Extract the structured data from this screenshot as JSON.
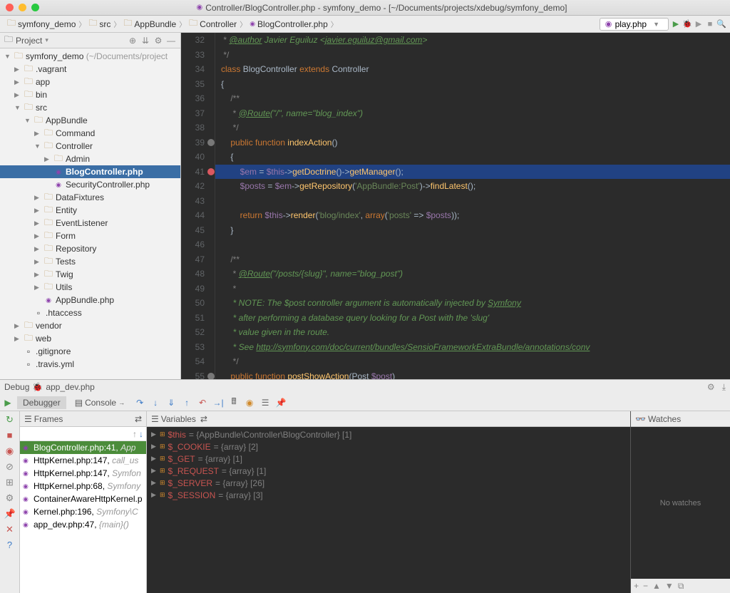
{
  "title": "Controller/BlogController.php - symfony_demo - [~/Documents/projects/xdebug/symfony_demo]",
  "breadcrumbs": [
    "symfony_demo",
    "src",
    "AppBundle",
    "Controller",
    "BlogController.php"
  ],
  "runconfig": "play.php",
  "projectPanel": {
    "title": "Project"
  },
  "tree": [
    {
      "depth": 0,
      "arrow": "▼",
      "icon": "folder",
      "label": "symfony_demo",
      "suffix": " (~/Documents/project"
    },
    {
      "depth": 1,
      "arrow": "▶",
      "icon": "folder",
      "label": ".vagrant"
    },
    {
      "depth": 1,
      "arrow": "▶",
      "icon": "folder",
      "label": "app"
    },
    {
      "depth": 1,
      "arrow": "▶",
      "icon": "folder",
      "label": "bin"
    },
    {
      "depth": 1,
      "arrow": "▼",
      "icon": "folder",
      "label": "src"
    },
    {
      "depth": 2,
      "arrow": "▼",
      "icon": "folder",
      "label": "AppBundle"
    },
    {
      "depth": 3,
      "arrow": "▶",
      "icon": "folder",
      "label": "Command"
    },
    {
      "depth": 3,
      "arrow": "▼",
      "icon": "folder",
      "label": "Controller"
    },
    {
      "depth": 4,
      "arrow": "▶",
      "icon": "folder",
      "label": "Admin"
    },
    {
      "depth": 4,
      "arrow": "",
      "icon": "php",
      "label": "BlogController.php",
      "selected": true
    },
    {
      "depth": 4,
      "arrow": "",
      "icon": "php",
      "label": "SecurityController.php"
    },
    {
      "depth": 3,
      "arrow": "▶",
      "icon": "folder",
      "label": "DataFixtures"
    },
    {
      "depth": 3,
      "arrow": "▶",
      "icon": "folder",
      "label": "Entity"
    },
    {
      "depth": 3,
      "arrow": "▶",
      "icon": "folder",
      "label": "EventListener"
    },
    {
      "depth": 3,
      "arrow": "▶",
      "icon": "folder",
      "label": "Form"
    },
    {
      "depth": 3,
      "arrow": "▶",
      "icon": "folder",
      "label": "Repository"
    },
    {
      "depth": 3,
      "arrow": "▶",
      "icon": "folder",
      "label": "Tests"
    },
    {
      "depth": 3,
      "arrow": "▶",
      "icon": "folder",
      "label": "Twig"
    },
    {
      "depth": 3,
      "arrow": "▶",
      "icon": "folder",
      "label": "Utils"
    },
    {
      "depth": 3,
      "arrow": "",
      "icon": "php",
      "label": "AppBundle.php"
    },
    {
      "depth": 2,
      "arrow": "",
      "icon": "file",
      "label": ".htaccess"
    },
    {
      "depth": 1,
      "arrow": "▶",
      "icon": "folder",
      "label": "vendor"
    },
    {
      "depth": 1,
      "arrow": "▶",
      "icon": "folder",
      "label": "web"
    },
    {
      "depth": 1,
      "arrow": "",
      "icon": "file",
      "label": ".gitignore"
    },
    {
      "depth": 1,
      "arrow": "",
      "icon": "file",
      "label": ".travis.yml"
    }
  ],
  "code": {
    "start": 32,
    "lines": [
      {
        "html": "<span class='cmt'> * </span><span class='doctag'>@author</span><span class='doc'> Javier Eguiluz &lt;</span><span class='doclink'>javier.eguiluz@gmail.com</span><span class='doc'>&gt;</span>"
      },
      {
        "html": "<span class='cmt'> */</span>"
      },
      {
        "html": "<span class='kw'>class</span> <span class='type'>BlogController</span> <span class='kw'>extends</span> <span class='type'>Controller</span>"
      },
      {
        "html": "{"
      },
      {
        "html": "    <span class='cmt'>/**</span>"
      },
      {
        "html": "<span class='cmt'>     * </span><span class='doctag'>@Route</span><span class='doc'>(\"/\", name=\"blog_index\")</span>"
      },
      {
        "html": "<span class='cmt'>     */</span>"
      },
      {
        "html": "    <span class='kw'>public function</span> <span class='fn'>indexAction</span>()",
        "gm": true
      },
      {
        "html": "    {"
      },
      {
        "html": "        <span class='var'>$em</span> = <span class='var'>$this</span>-&gt;<span class='fn'>getDoctrine</span>()-&gt;<span class='fn'>getManager</span>();",
        "hl": true,
        "bp": true
      },
      {
        "html": "        <span class='var'>$posts</span> = <span class='var'>$em</span>-&gt;<span class='fn'>getRepository</span>(<span class='str'>'AppBundle:Post'</span>)-&gt;<span class='fn'>findLatest</span>();"
      },
      {
        "html": ""
      },
      {
        "html": "        <span class='kw'>return</span> <span class='var'>$this</span>-&gt;<span class='fn'>render</span>(<span class='str'>'blog/index'</span>, <span class='kw'>array</span>(<span class='str'>'posts'</span> =&gt; <span class='var'>$posts</span>));"
      },
      {
        "html": "    }"
      },
      {
        "html": ""
      },
      {
        "html": "    <span class='cmt'>/**</span>"
      },
      {
        "html": "<span class='cmt'>     * </span><span class='doctag'>@Route</span><span class='doc'>(\"/posts/{slug}\", name=\"blog_post\")</span>"
      },
      {
        "html": "<span class='cmt'>     *</span>"
      },
      {
        "html": "<span class='doc'>     * NOTE: The $post controller argument is automatically injected by </span><span class='doclink'>Symfony</span>"
      },
      {
        "html": "<span class='doc'>     * after performing a database query looking for a Post with the 'slug'</span>"
      },
      {
        "html": "<span class='doc'>     * value given in the route.</span>"
      },
      {
        "html": "<span class='doc'>     * See </span><span class='doclink'>http://symfony.com/doc/current/bundles/SensioFrameworkExtraBundle/annotations/conv</span>"
      },
      {
        "html": "<span class='cmt'>     */</span>"
      },
      {
        "html": "    <span class='kw'>public function</span> <span class='fn'>postShowAction</span>(Post <span class='var'>$post</span>)",
        "gm": true
      }
    ]
  },
  "debug": {
    "title": "Debug",
    "session": "app_dev.php",
    "tabs": {
      "debugger": "Debugger",
      "console": "Console"
    },
    "framesTitle": "Frames",
    "varsTitle": "Variables",
    "watchesTitle": "Watches",
    "noWatches": "No watches",
    "frames": [
      {
        "label": "BlogController.php:41,",
        "ctx": "App",
        "selected": true
      },
      {
        "label": "HttpKernel.php:147,",
        "ctx": "call_us"
      },
      {
        "label": "HttpKernel.php:147,",
        "ctx": "Symfon"
      },
      {
        "label": "HttpKernel.php:68,",
        "ctx": "Symfony"
      },
      {
        "label": "ContainerAwareHttpKernel.p",
        "ctx": ""
      },
      {
        "label": "Kernel.php:196,",
        "ctx": "Symfony\\C"
      },
      {
        "label": "app_dev.php:47,",
        "ctx": "{main}()"
      }
    ],
    "vars": [
      {
        "name": "$this",
        "val": "= {AppBundle\\Controller\\BlogController} [1]"
      },
      {
        "name": "$_COOKIE",
        "val": "= {array} [2]"
      },
      {
        "name": "$_GET",
        "val": "= {array} [1]"
      },
      {
        "name": "$_REQUEST",
        "val": "= {array} [1]"
      },
      {
        "name": "$_SERVER",
        "val": "= {array} [26]"
      },
      {
        "name": "$_SESSION",
        "val": "= {array} [3]"
      }
    ]
  }
}
